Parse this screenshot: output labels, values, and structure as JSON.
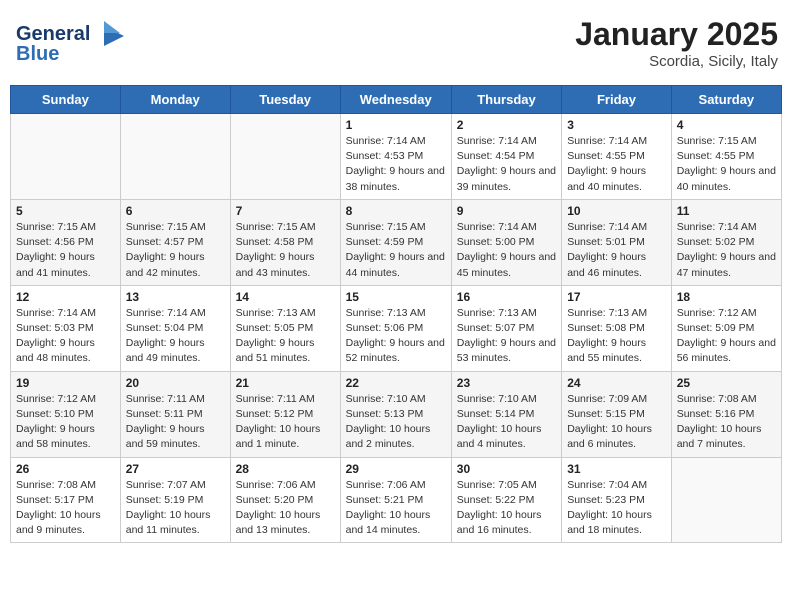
{
  "header": {
    "logo_line1": "General",
    "logo_line2": "Blue",
    "title": "January 2025",
    "subtitle": "Scordia, Sicily, Italy"
  },
  "weekdays": [
    "Sunday",
    "Monday",
    "Tuesday",
    "Wednesday",
    "Thursday",
    "Friday",
    "Saturday"
  ],
  "rows": [
    [
      {
        "day": "",
        "info": ""
      },
      {
        "day": "",
        "info": ""
      },
      {
        "day": "",
        "info": ""
      },
      {
        "day": "1",
        "info": "Sunrise: 7:14 AM\nSunset: 4:53 PM\nDaylight: 9 hours and 38 minutes."
      },
      {
        "day": "2",
        "info": "Sunrise: 7:14 AM\nSunset: 4:54 PM\nDaylight: 9 hours and 39 minutes."
      },
      {
        "day": "3",
        "info": "Sunrise: 7:14 AM\nSunset: 4:55 PM\nDaylight: 9 hours and 40 minutes."
      },
      {
        "day": "4",
        "info": "Sunrise: 7:15 AM\nSunset: 4:55 PM\nDaylight: 9 hours and 40 minutes."
      }
    ],
    [
      {
        "day": "5",
        "info": "Sunrise: 7:15 AM\nSunset: 4:56 PM\nDaylight: 9 hours and 41 minutes."
      },
      {
        "day": "6",
        "info": "Sunrise: 7:15 AM\nSunset: 4:57 PM\nDaylight: 9 hours and 42 minutes."
      },
      {
        "day": "7",
        "info": "Sunrise: 7:15 AM\nSunset: 4:58 PM\nDaylight: 9 hours and 43 minutes."
      },
      {
        "day": "8",
        "info": "Sunrise: 7:15 AM\nSunset: 4:59 PM\nDaylight: 9 hours and 44 minutes."
      },
      {
        "day": "9",
        "info": "Sunrise: 7:14 AM\nSunset: 5:00 PM\nDaylight: 9 hours and 45 minutes."
      },
      {
        "day": "10",
        "info": "Sunrise: 7:14 AM\nSunset: 5:01 PM\nDaylight: 9 hours and 46 minutes."
      },
      {
        "day": "11",
        "info": "Sunrise: 7:14 AM\nSunset: 5:02 PM\nDaylight: 9 hours and 47 minutes."
      }
    ],
    [
      {
        "day": "12",
        "info": "Sunrise: 7:14 AM\nSunset: 5:03 PM\nDaylight: 9 hours and 48 minutes."
      },
      {
        "day": "13",
        "info": "Sunrise: 7:14 AM\nSunset: 5:04 PM\nDaylight: 9 hours and 49 minutes."
      },
      {
        "day": "14",
        "info": "Sunrise: 7:13 AM\nSunset: 5:05 PM\nDaylight: 9 hours and 51 minutes."
      },
      {
        "day": "15",
        "info": "Sunrise: 7:13 AM\nSunset: 5:06 PM\nDaylight: 9 hours and 52 minutes."
      },
      {
        "day": "16",
        "info": "Sunrise: 7:13 AM\nSunset: 5:07 PM\nDaylight: 9 hours and 53 minutes."
      },
      {
        "day": "17",
        "info": "Sunrise: 7:13 AM\nSunset: 5:08 PM\nDaylight: 9 hours and 55 minutes."
      },
      {
        "day": "18",
        "info": "Sunrise: 7:12 AM\nSunset: 5:09 PM\nDaylight: 9 hours and 56 minutes."
      }
    ],
    [
      {
        "day": "19",
        "info": "Sunrise: 7:12 AM\nSunset: 5:10 PM\nDaylight: 9 hours and 58 minutes."
      },
      {
        "day": "20",
        "info": "Sunrise: 7:11 AM\nSunset: 5:11 PM\nDaylight: 9 hours and 59 minutes."
      },
      {
        "day": "21",
        "info": "Sunrise: 7:11 AM\nSunset: 5:12 PM\nDaylight: 10 hours and 1 minute."
      },
      {
        "day": "22",
        "info": "Sunrise: 7:10 AM\nSunset: 5:13 PM\nDaylight: 10 hours and 2 minutes."
      },
      {
        "day": "23",
        "info": "Sunrise: 7:10 AM\nSunset: 5:14 PM\nDaylight: 10 hours and 4 minutes."
      },
      {
        "day": "24",
        "info": "Sunrise: 7:09 AM\nSunset: 5:15 PM\nDaylight: 10 hours and 6 minutes."
      },
      {
        "day": "25",
        "info": "Sunrise: 7:08 AM\nSunset: 5:16 PM\nDaylight: 10 hours and 7 minutes."
      }
    ],
    [
      {
        "day": "26",
        "info": "Sunrise: 7:08 AM\nSunset: 5:17 PM\nDaylight: 10 hours and 9 minutes."
      },
      {
        "day": "27",
        "info": "Sunrise: 7:07 AM\nSunset: 5:19 PM\nDaylight: 10 hours and 11 minutes."
      },
      {
        "day": "28",
        "info": "Sunrise: 7:06 AM\nSunset: 5:20 PM\nDaylight: 10 hours and 13 minutes."
      },
      {
        "day": "29",
        "info": "Sunrise: 7:06 AM\nSunset: 5:21 PM\nDaylight: 10 hours and 14 minutes."
      },
      {
        "day": "30",
        "info": "Sunrise: 7:05 AM\nSunset: 5:22 PM\nDaylight: 10 hours and 16 minutes."
      },
      {
        "day": "31",
        "info": "Sunrise: 7:04 AM\nSunset: 5:23 PM\nDaylight: 10 hours and 18 minutes."
      },
      {
        "day": "",
        "info": ""
      }
    ]
  ]
}
